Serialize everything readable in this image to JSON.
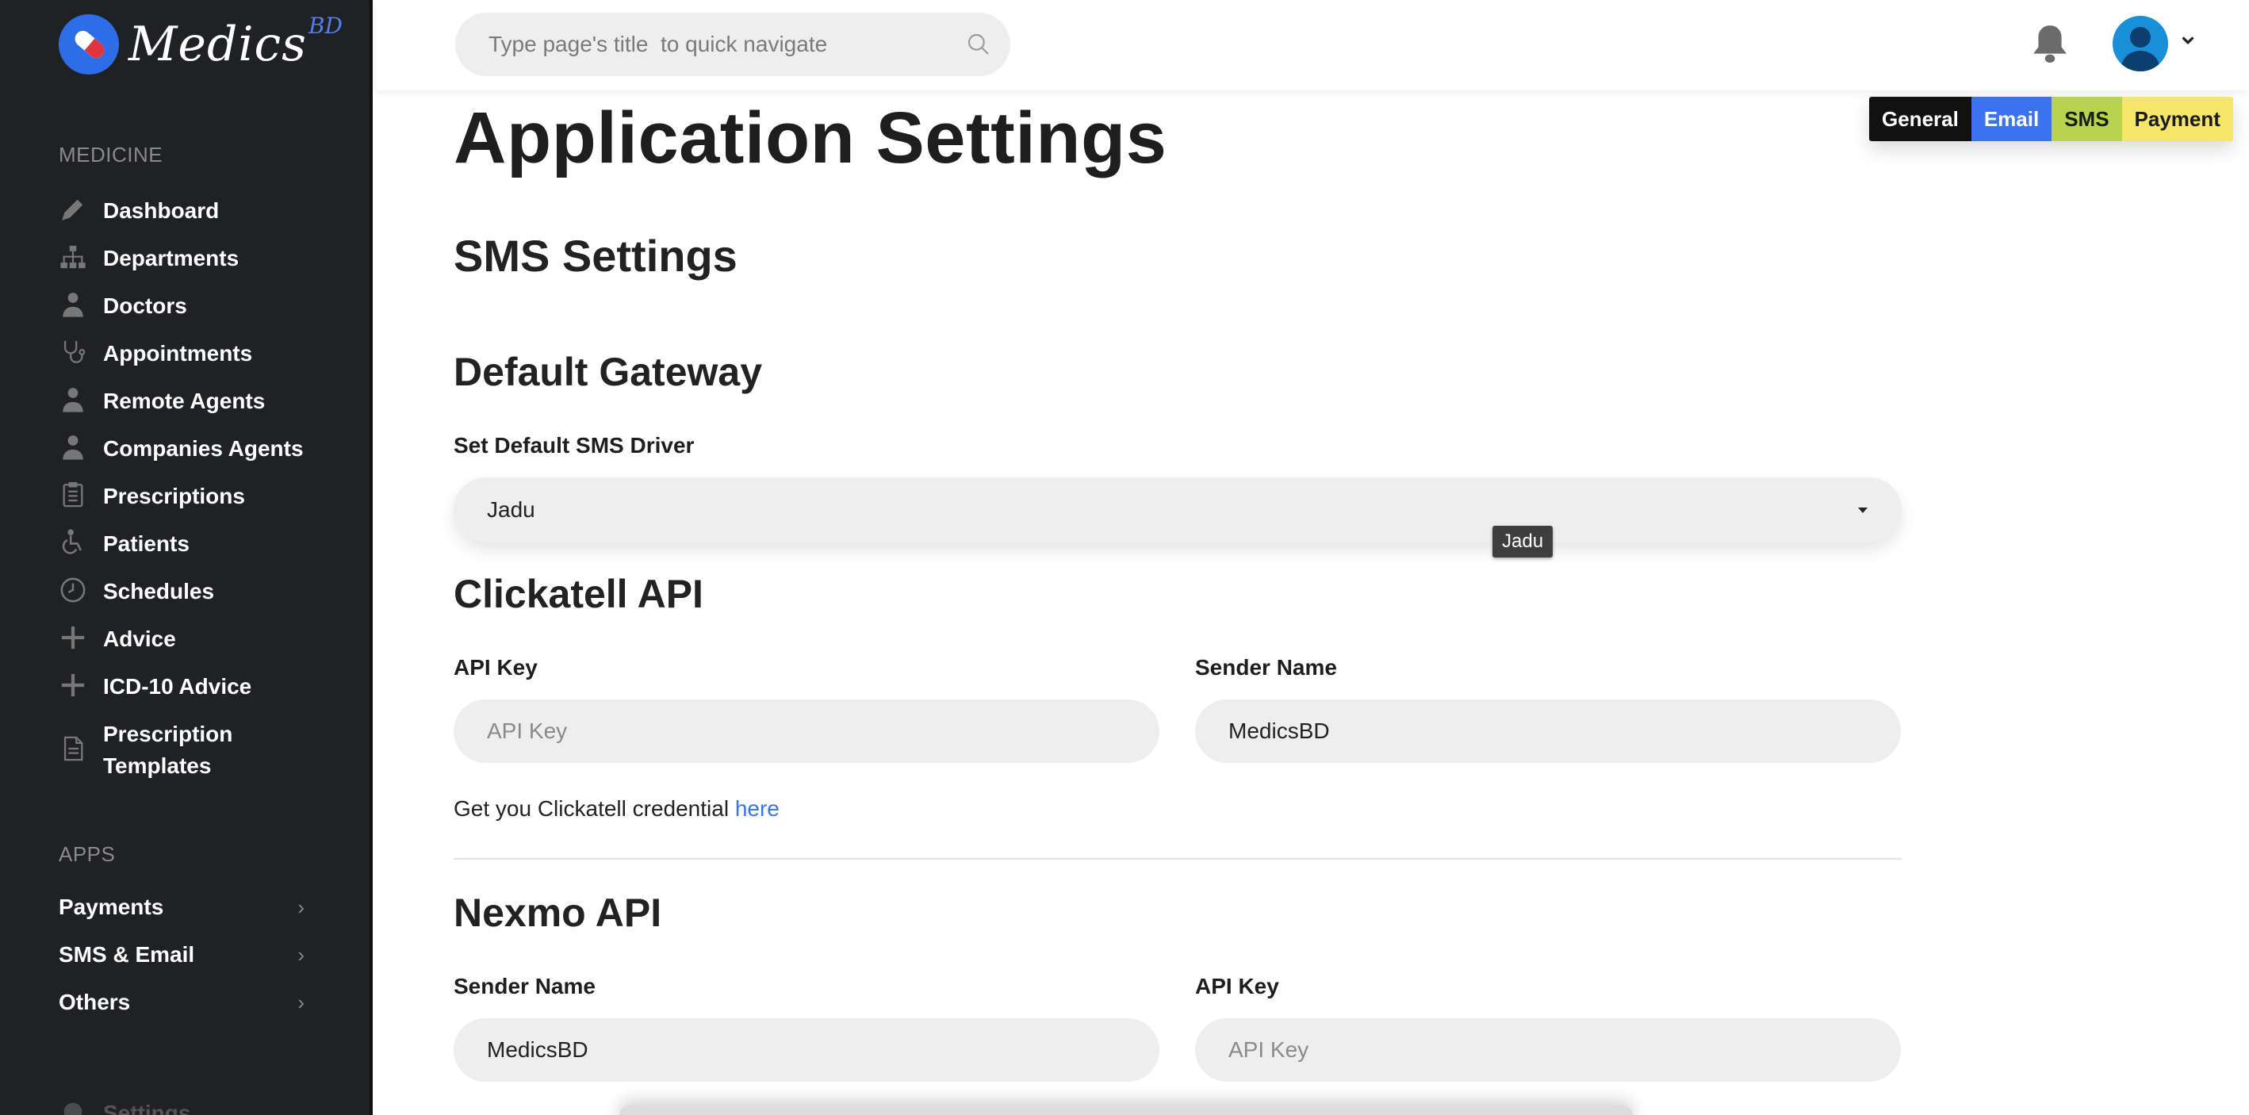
{
  "brand": {
    "name": "Medics",
    "suffix": "BD"
  },
  "sidebar": {
    "section_medicine": "MEDICINE",
    "items": [
      {
        "label": "Dashboard",
        "icon": "pen-icon"
      },
      {
        "label": "Departments",
        "icon": "sitemap-icon"
      },
      {
        "label": "Doctors",
        "icon": "doctor-icon"
      },
      {
        "label": "Appointments",
        "icon": "stethoscope-icon"
      },
      {
        "label": "Remote Agents",
        "icon": "agent-icon"
      },
      {
        "label": "Companies Agents",
        "icon": "agent-icon"
      },
      {
        "label": "Prescriptions",
        "icon": "clipboard-icon"
      },
      {
        "label": "Patients",
        "icon": "wheelchair-icon"
      },
      {
        "label": "Schedules",
        "icon": "clock-icon"
      },
      {
        "label": "Advice",
        "icon": "plus-icon"
      },
      {
        "label": "ICD-10 Advice",
        "icon": "plus-icon"
      },
      {
        "label": "Prescription Templates",
        "icon": "document-icon"
      }
    ],
    "section_apps": "APPS",
    "apps": [
      {
        "label": "Payments"
      },
      {
        "label": "SMS & Email"
      },
      {
        "label": "Others"
      }
    ],
    "settings_label": "Settings"
  },
  "topbar": {
    "search_placeholder": "Type page's title  to quick navigate"
  },
  "main": {
    "page_title": "Application Settings",
    "section_title": "SMS Settings",
    "tabs": [
      "General",
      "Email",
      "SMS",
      "Payment"
    ],
    "default_gateway": {
      "heading": "Default Gateway",
      "driver_label": "Set Default SMS Driver",
      "driver_value": "Jadu",
      "tooltip": "Jadu"
    },
    "clickatell": {
      "heading": "Clickatell API",
      "api_key_label": "API Key",
      "api_key_placeholder": "API Key",
      "api_key_value": "",
      "sender_label": "Sender Name",
      "sender_value": "MedicsBD",
      "help_prefix": "Get you Clickatell credential ",
      "help_link": "here"
    },
    "nexmo": {
      "heading": "Nexmo API",
      "sender_label": "Sender Name",
      "sender_value": "MedicsBD",
      "api_key_label": "API Key",
      "api_key_placeholder": "API Key",
      "api_key_value": ""
    }
  },
  "colors": {
    "sidebar_bg": "#202124",
    "accent_blue": "#3b73ef",
    "tab_general": "#111111",
    "tab_email": "#3b73ef",
    "tab_sms": "#b9d34f",
    "tab_payment": "#f4e66a"
  }
}
